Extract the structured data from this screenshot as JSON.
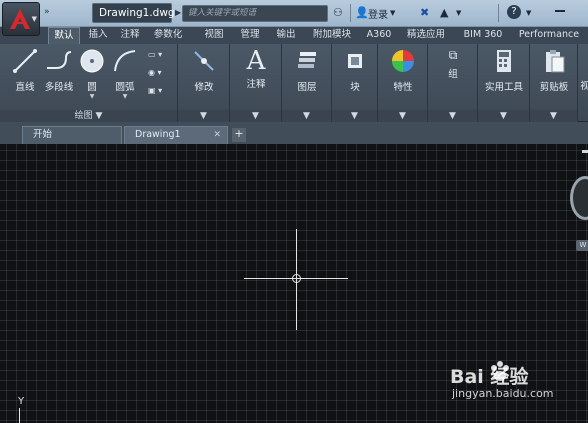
{
  "title_bar": {
    "document_title": "Drawing1.dwg",
    "search_placeholder": "键入关键字或短语",
    "login_label": "登录",
    "help_label": "?"
  },
  "ribbon_tabs": [
    "默认",
    "插入",
    "注释",
    "参数化",
    "视图",
    "管理",
    "输出",
    "附加模块",
    "A360",
    "精选应用",
    "BIM 360",
    "Performance"
  ],
  "ribbon": {
    "draw_panel": {
      "line": "直线",
      "polyline": "多段线",
      "circle": "圆",
      "arc": "圆弧",
      "footer": "绘图"
    },
    "modify_panel": {
      "label": "修改"
    },
    "annotation_panel": {
      "label": "注释"
    },
    "layers_panel": {
      "label": "图层"
    },
    "block_panel": {
      "label": "块"
    },
    "properties_panel": {
      "label": "特性"
    },
    "groups_panel": {
      "label": "组"
    },
    "utilities_panel": {
      "label": "实用工具"
    },
    "clipboard_panel": {
      "label": "剪贴板"
    },
    "view_panel_partial": "视"
  },
  "file_tabs": {
    "start": "开始",
    "drawing": "Drawing1",
    "new_tab": "+"
  },
  "canvas": {
    "ucs_axis_label": "Y",
    "w_label": "W"
  },
  "watermark": {
    "brand": "Bai 经验",
    "url": "jingyan.baidu.com"
  },
  "colors": {
    "accent_logo": "#c8262b",
    "canvas_bg": "#0f1113",
    "ribbon_bg": "#4b5866"
  }
}
